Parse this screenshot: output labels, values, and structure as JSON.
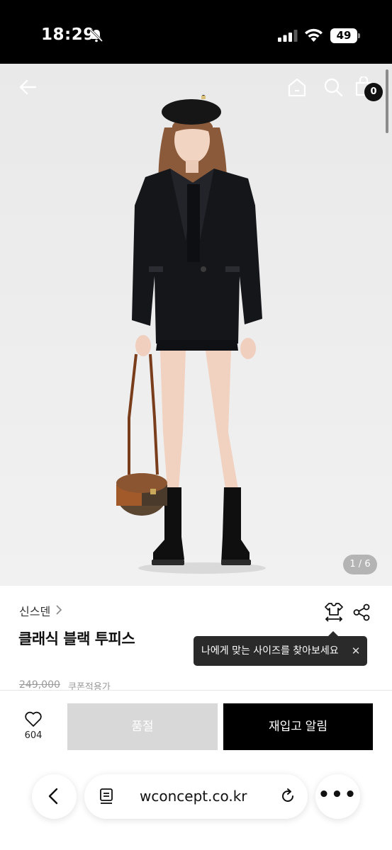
{
  "status_bar": {
    "time": "18:29",
    "battery": "49",
    "icons": [
      "bell-off-icon",
      "signal-icon",
      "wifi-icon",
      "battery-icon"
    ]
  },
  "header": {
    "cart_count": "0",
    "icons": [
      "back-arrow-icon",
      "home-icon",
      "search-icon",
      "shopping-bag-icon"
    ]
  },
  "gallery": {
    "indicator": "1 / 6"
  },
  "product": {
    "brand": "신스덴",
    "name": "클래식 블랙 투피스",
    "original_price": "249,000",
    "coupon_label": "쿠폰적용가"
  },
  "tooltip": {
    "text": "나에게 맞는 사이즈를 찾아보세요",
    "close": "✕"
  },
  "actions": {
    "like_count": "604",
    "soldout_label": "품절",
    "restock_label": "재입고 알림"
  },
  "browser": {
    "url": "wconcept.co.kr",
    "more": "•••"
  },
  "colors": {
    "primary_button": "#000000",
    "disabled_button": "#d8d8d8",
    "tooltip_bg": "#2a2a2a",
    "photo_bg": "#ebebeb"
  }
}
